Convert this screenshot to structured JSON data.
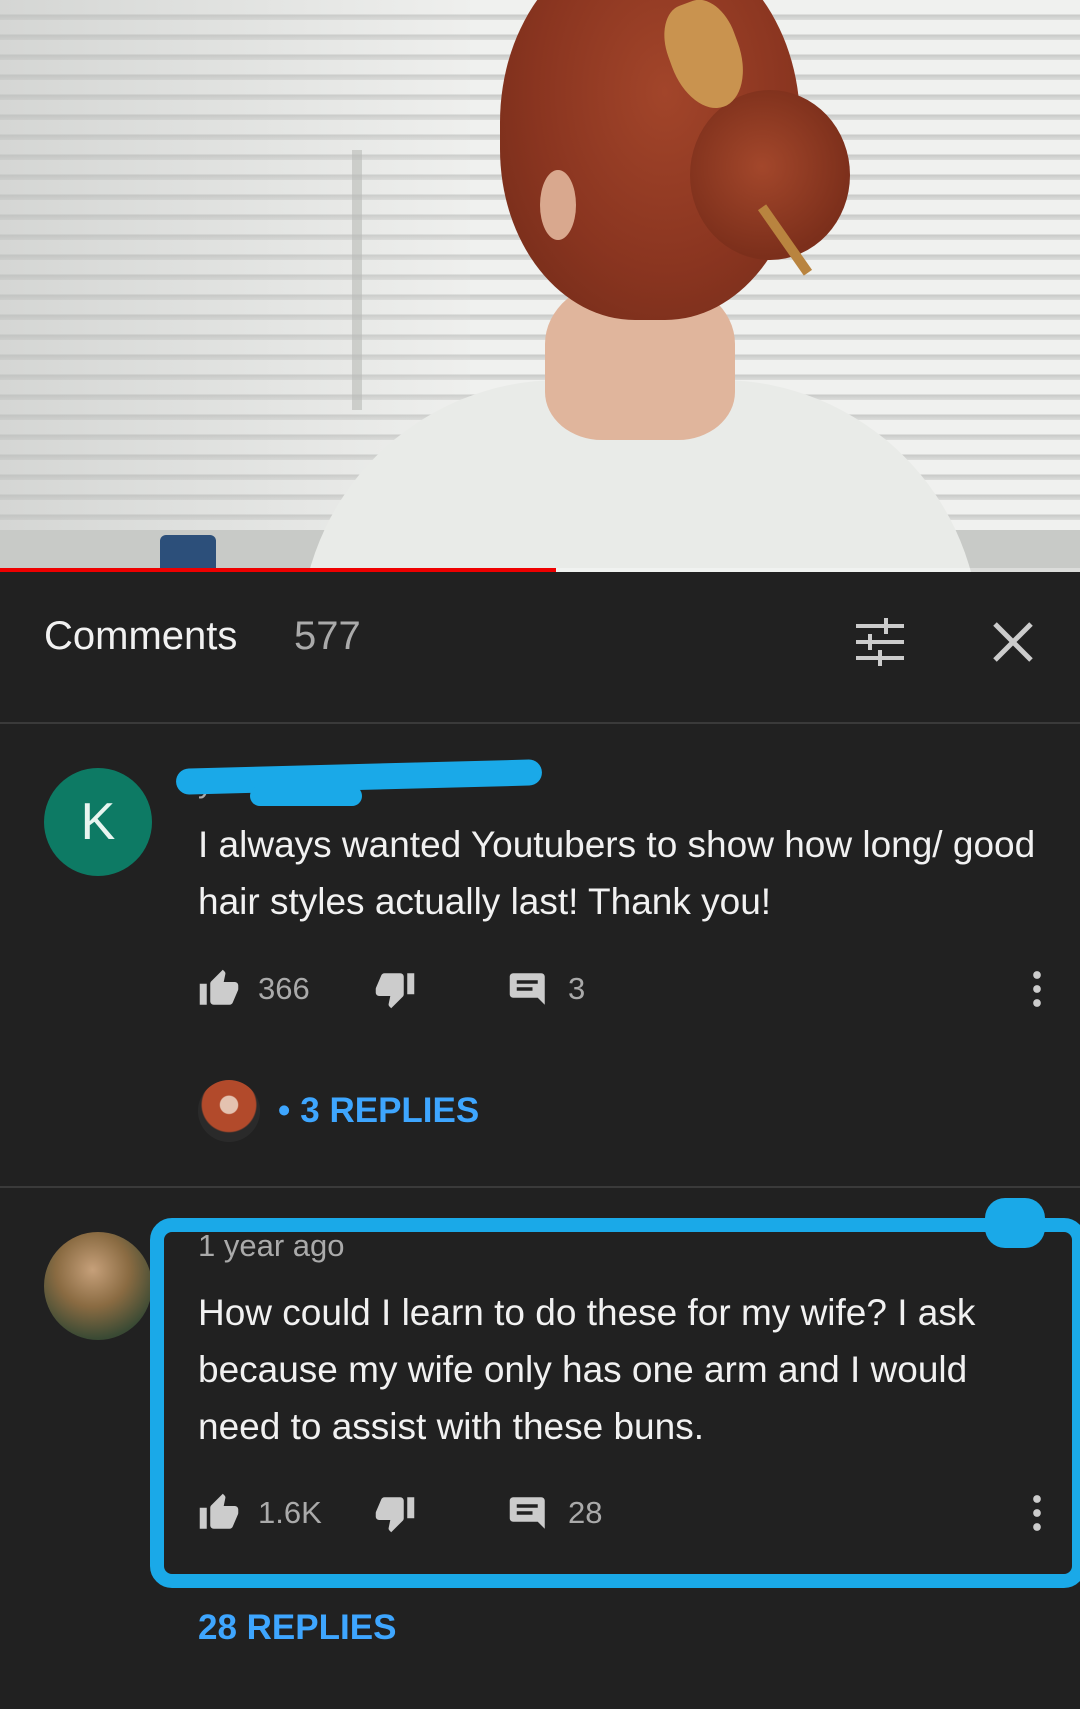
{
  "video": {
    "progress_fraction": 0.515
  },
  "comments_header": {
    "title": "Comments",
    "count": "577"
  },
  "comments": [
    {
      "avatar_letter": "K",
      "meta": "years ago",
      "text": "I always wanted Youtubers to show how long/ good hair styles actually last! Thank you!",
      "likes": "366",
      "replies_count": "3",
      "replies_label": "3 REPLIES"
    },
    {
      "meta": "1 year ago",
      "text": "How could I learn to do these for my wife?  I ask because my wife only has one arm and I would need to assist with these buns.",
      "likes": "1.6K",
      "replies_count": "28",
      "replies_label": "28 REPLIES"
    }
  ],
  "colors": {
    "background": "#212121",
    "link_blue": "#3ea6ff",
    "progress_red": "#ee0000",
    "annotation_blue": "#1aa9e8"
  },
  "icons": [
    "filter-icon",
    "close-icon",
    "like-icon",
    "dislike-icon",
    "reply-icon",
    "more-vert-icon"
  ]
}
